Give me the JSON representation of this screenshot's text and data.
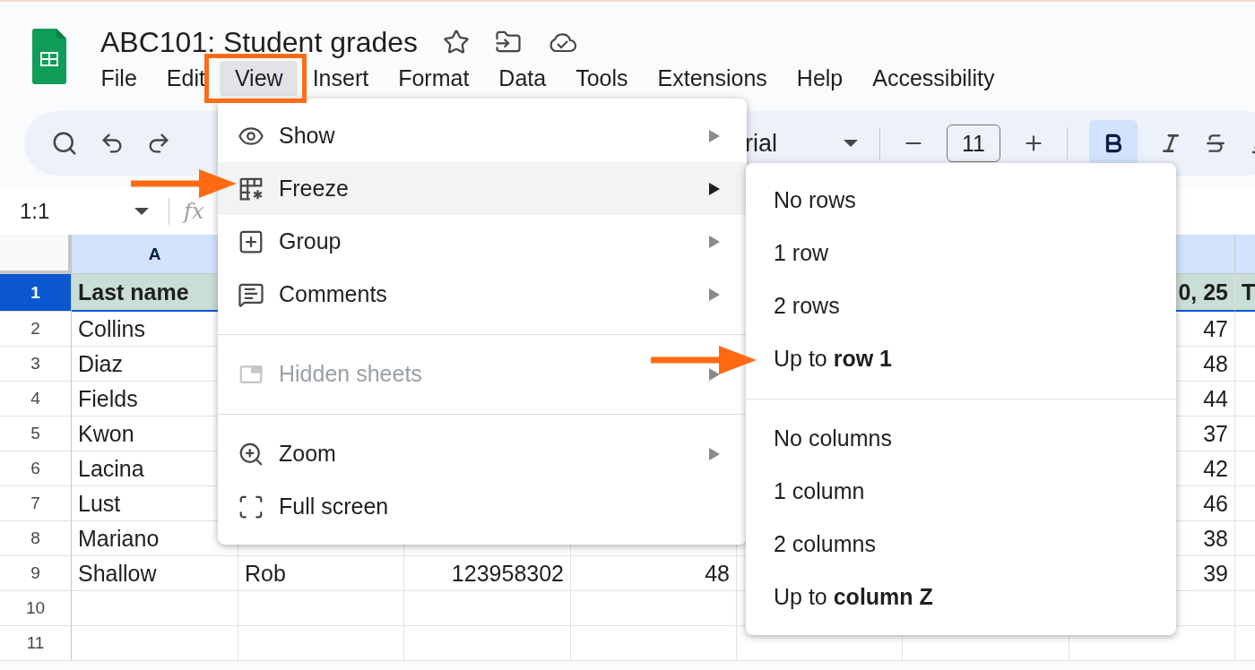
{
  "document": {
    "title": "ABC101: Student grades"
  },
  "menubar": [
    {
      "label": "File",
      "selected": false
    },
    {
      "label": "Edit",
      "selected": false
    },
    {
      "label": "View",
      "selected": true
    },
    {
      "label": "Insert",
      "selected": false
    },
    {
      "label": "Format",
      "selected": false
    },
    {
      "label": "Data",
      "selected": false
    },
    {
      "label": "Tools",
      "selected": false
    },
    {
      "label": "Extensions",
      "selected": false
    },
    {
      "label": "Help",
      "selected": false
    },
    {
      "label": "Accessibility",
      "selected": false
    }
  ],
  "toolbar": {
    "font": "rial",
    "font_size": "11",
    "bold_active": true
  },
  "formula_bar": {
    "name_box": "1:1",
    "function_label": "fx"
  },
  "sheet": {
    "column_headers": [
      "A"
    ],
    "rows": [
      {
        "number": "1",
        "selected": true,
        "kind": "header",
        "cells": [
          "Last name",
          null,
          null,
          null,
          null,
          null,
          "0, 25",
          "T"
        ]
      },
      {
        "number": "2",
        "selected": false,
        "kind": "data",
        "cells": [
          "Collins",
          null,
          null,
          null,
          null,
          null,
          "47",
          null
        ]
      },
      {
        "number": "3",
        "selected": false,
        "kind": "data",
        "cells": [
          "Diaz",
          null,
          null,
          null,
          null,
          null,
          "48",
          null
        ]
      },
      {
        "number": "4",
        "selected": false,
        "kind": "data",
        "cells": [
          "Fields",
          null,
          null,
          null,
          null,
          null,
          "44",
          null
        ]
      },
      {
        "number": "5",
        "selected": false,
        "kind": "data",
        "cells": [
          "Kwon",
          null,
          null,
          null,
          null,
          null,
          "37",
          null
        ]
      },
      {
        "number": "6",
        "selected": false,
        "kind": "data",
        "cells": [
          "Lacina",
          null,
          null,
          null,
          null,
          null,
          "42",
          null
        ]
      },
      {
        "number": "7",
        "selected": false,
        "kind": "data",
        "cells": [
          "Lust",
          null,
          null,
          null,
          null,
          null,
          "46",
          null
        ]
      },
      {
        "number": "8",
        "selected": false,
        "kind": "data",
        "cells": [
          "Mariano",
          null,
          null,
          null,
          null,
          null,
          "38",
          null
        ]
      },
      {
        "number": "9",
        "selected": false,
        "kind": "data",
        "cells": [
          "Shallow",
          "Rob",
          "123958302",
          "48",
          null,
          null,
          "39",
          null
        ]
      },
      {
        "number": "10",
        "selected": false,
        "kind": "data",
        "cells": []
      },
      {
        "number": "11",
        "selected": false,
        "kind": "data",
        "cells": []
      }
    ]
  },
  "view_menu": [
    {
      "kind": "item",
      "label": "Show",
      "selected": false,
      "disabled": false
    },
    {
      "kind": "item",
      "label": "Freeze",
      "selected": true,
      "disabled": false
    },
    {
      "kind": "item",
      "label": "Group",
      "selected": false,
      "disabled": false
    },
    {
      "kind": "item",
      "label": "Comments",
      "selected": false,
      "disabled": false
    },
    {
      "kind": "divider"
    },
    {
      "kind": "item",
      "label": "Hidden sheets",
      "selected": false,
      "disabled": true
    },
    {
      "kind": "divider"
    },
    {
      "kind": "item",
      "label": "Zoom",
      "selected": false,
      "disabled": false
    },
    {
      "kind": "leaf",
      "label": "Full screen",
      "selected": false,
      "disabled": false
    }
  ],
  "freeze_submenu": [
    {
      "kind": "item",
      "label": "No rows"
    },
    {
      "kind": "item",
      "label": "1 row"
    },
    {
      "kind": "item",
      "label": "2 rows"
    },
    {
      "kind": "item",
      "label": "Up to **row 1**"
    },
    {
      "kind": "divider"
    },
    {
      "kind": "item",
      "label": "No columns"
    },
    {
      "kind": "item",
      "label": "1 column"
    },
    {
      "kind": "item",
      "label": "2 columns"
    },
    {
      "kind": "item",
      "label": "Up to **column Z**"
    }
  ],
  "annotations": [
    {
      "kind": "box"
    },
    {
      "kind": "arrow"
    },
    {
      "kind": "arrow"
    }
  ]
}
